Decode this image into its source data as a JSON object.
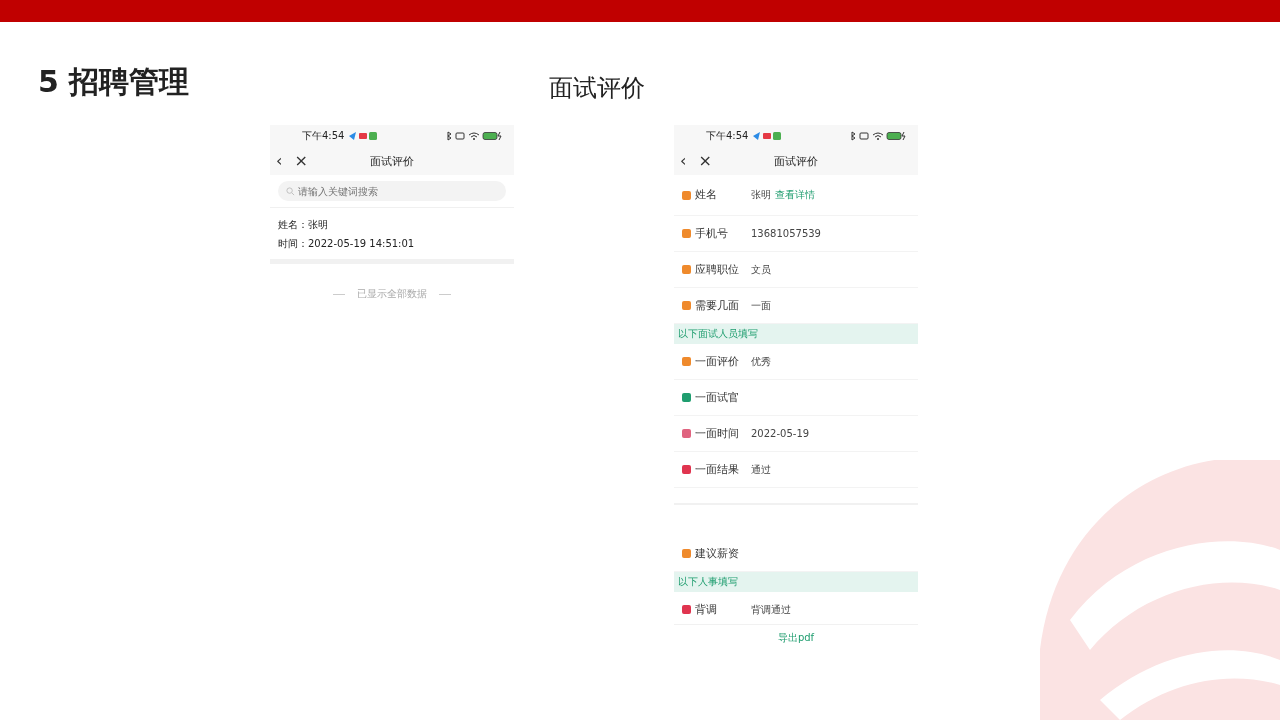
{
  "slide": {
    "title": "5 招聘管理",
    "subtitle": "面试评价"
  },
  "list_screen": {
    "status_bar": {
      "time": "下午4:54"
    },
    "nav": {
      "back": "‹",
      "close": "×",
      "title": "面试评价"
    },
    "search": {
      "placeholder": "请输入关键词搜索"
    },
    "records": [
      {
        "name_label": "姓名：",
        "name": "张明",
        "time_label": "时间：",
        "time": "2022-05-19 14:51:01"
      }
    ],
    "end_note": "已显示全部数据"
  },
  "detail_screen": {
    "status_bar": {
      "time": "下午4:54"
    },
    "nav": {
      "back": "‹",
      "close": "×",
      "title": "面试评价"
    },
    "rows": [
      {
        "kind": "field",
        "label": "姓名",
        "value": "张明",
        "link": "查看详情",
        "color": "#ef8a2c"
      },
      {
        "kind": "field",
        "label": "手机号",
        "value": "13681057539",
        "color": "#ef8a2c"
      },
      {
        "kind": "field",
        "label": "应聘职位",
        "value": "文员",
        "color": "#ef8a2c"
      },
      {
        "kind": "field",
        "label": "需要几面",
        "value": "一面",
        "color": "#ef8a2c"
      },
      {
        "kind": "section",
        "label": "以下面试人员填写"
      },
      {
        "kind": "field",
        "label": "一面评价",
        "value": "优秀",
        "color": "#ef8a2c"
      },
      {
        "kind": "field",
        "label": "一面试官",
        "color": "#1f9d6f"
      },
      {
        "kind": "field",
        "label": "一面时间",
        "value": "2022-05-19",
        "color": "#e0637f"
      },
      {
        "kind": "field",
        "label": "一面结果",
        "value": "通过",
        "color": "#e0344f"
      },
      {
        "kind": "gap"
      },
      {
        "kind": "field",
        "label": "建议薪资",
        "color": "#ef8a2c"
      },
      {
        "kind": "section",
        "label": "以下人事填写"
      },
      {
        "kind": "field",
        "label": "背调",
        "value": "背调通过",
        "color": "#e0344f"
      }
    ],
    "export_button": "导出pdf"
  }
}
